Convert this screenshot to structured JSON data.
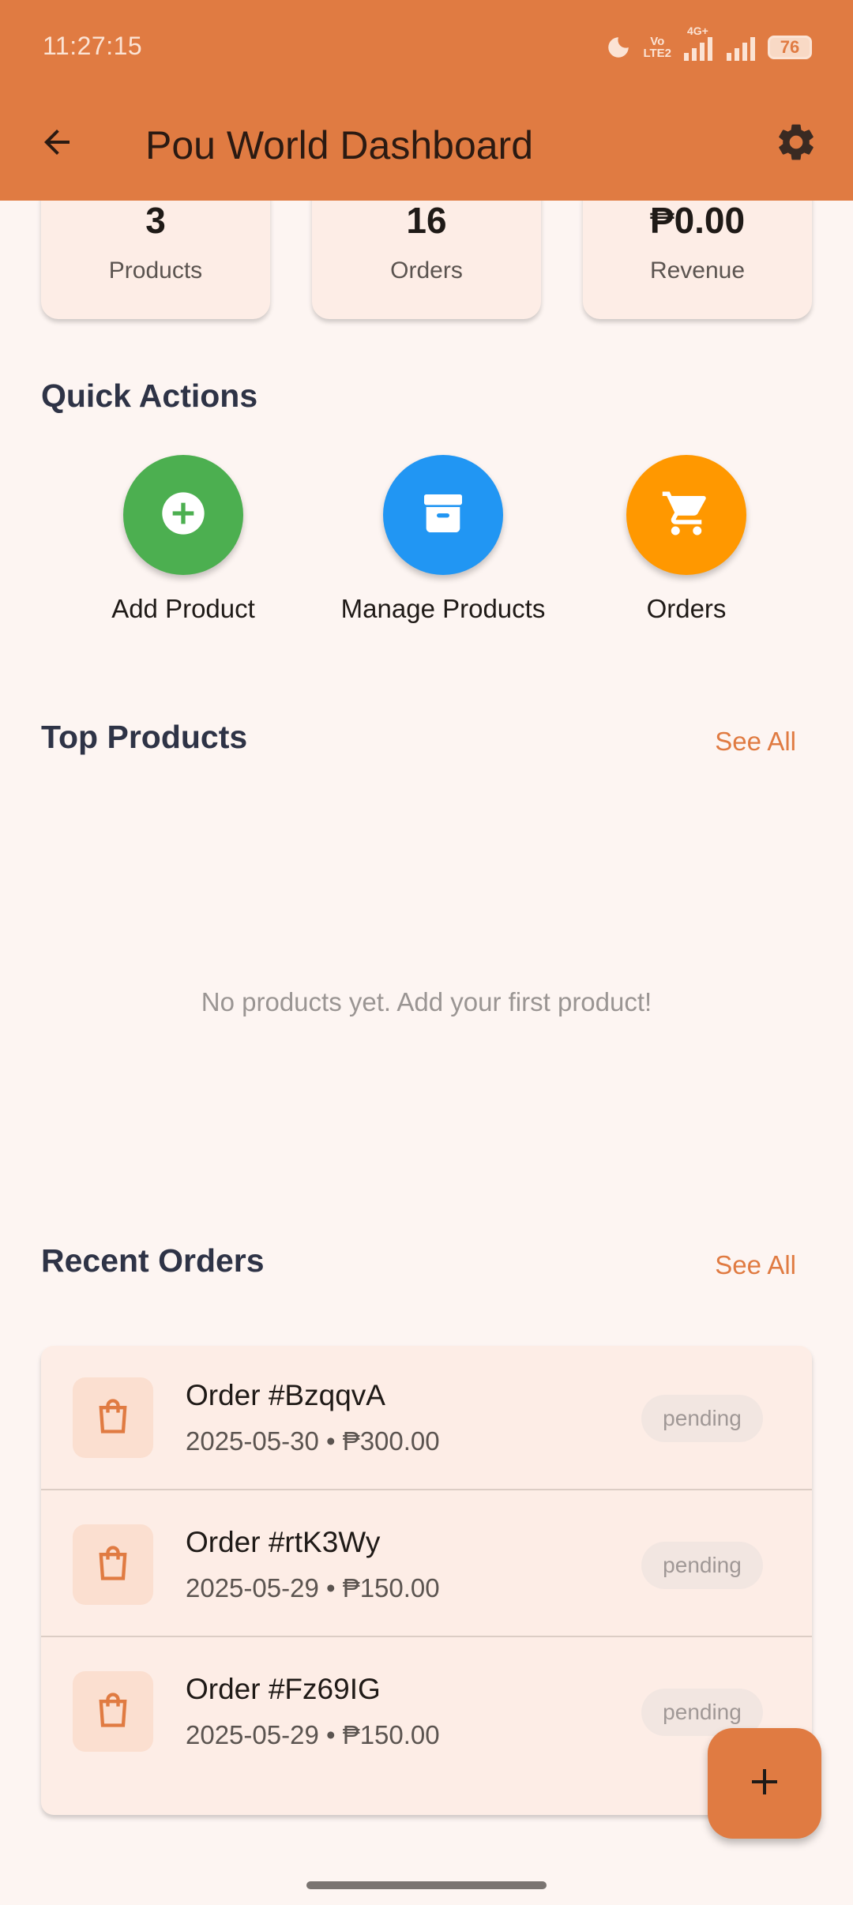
{
  "status_bar": {
    "time": "11:27:15",
    "volte_line1": "Vo",
    "volte_line2": "LTE2",
    "network": "4G+",
    "battery": "76"
  },
  "app_bar": {
    "title": "Pou World Dashboard",
    "back_icon": "arrow-left-icon",
    "settings_icon": "gear-icon"
  },
  "stats": [
    {
      "value": "3",
      "label": "Products"
    },
    {
      "value": "16",
      "label": "Orders"
    },
    {
      "value": "₱0.00",
      "label": "Revenue"
    }
  ],
  "quick_actions": {
    "title": "Quick Actions",
    "items": [
      {
        "label": "Add Product",
        "icon": "plus-circle-icon",
        "color": "#4CAF50"
      },
      {
        "label": "Manage Products",
        "icon": "archive-box-icon",
        "color": "#2196F3"
      },
      {
        "label": "Orders",
        "icon": "shopping-cart-icon",
        "color": "#FF9800"
      }
    ]
  },
  "top_products": {
    "title": "Top Products",
    "see_all": "See All",
    "empty_message": "No products yet. Add your first product!"
  },
  "recent_orders": {
    "title": "Recent Orders",
    "see_all": "See All",
    "orders": [
      {
        "id": "Order #BzqqvA",
        "meta": "2025-05-30 • ₱300.00",
        "status": "pending"
      },
      {
        "id": "Order #rtK3Wy",
        "meta": "2025-05-29 • ₱150.00",
        "status": "pending"
      },
      {
        "id": "Order #Fz69IG",
        "meta": "2025-05-29 • ₱150.00",
        "status": "pending"
      }
    ]
  },
  "fab": {
    "icon": "plus-icon"
  },
  "colors": {
    "primary": "#E07B42",
    "background": "#FDF5F2",
    "card": "#FDEDE6"
  }
}
